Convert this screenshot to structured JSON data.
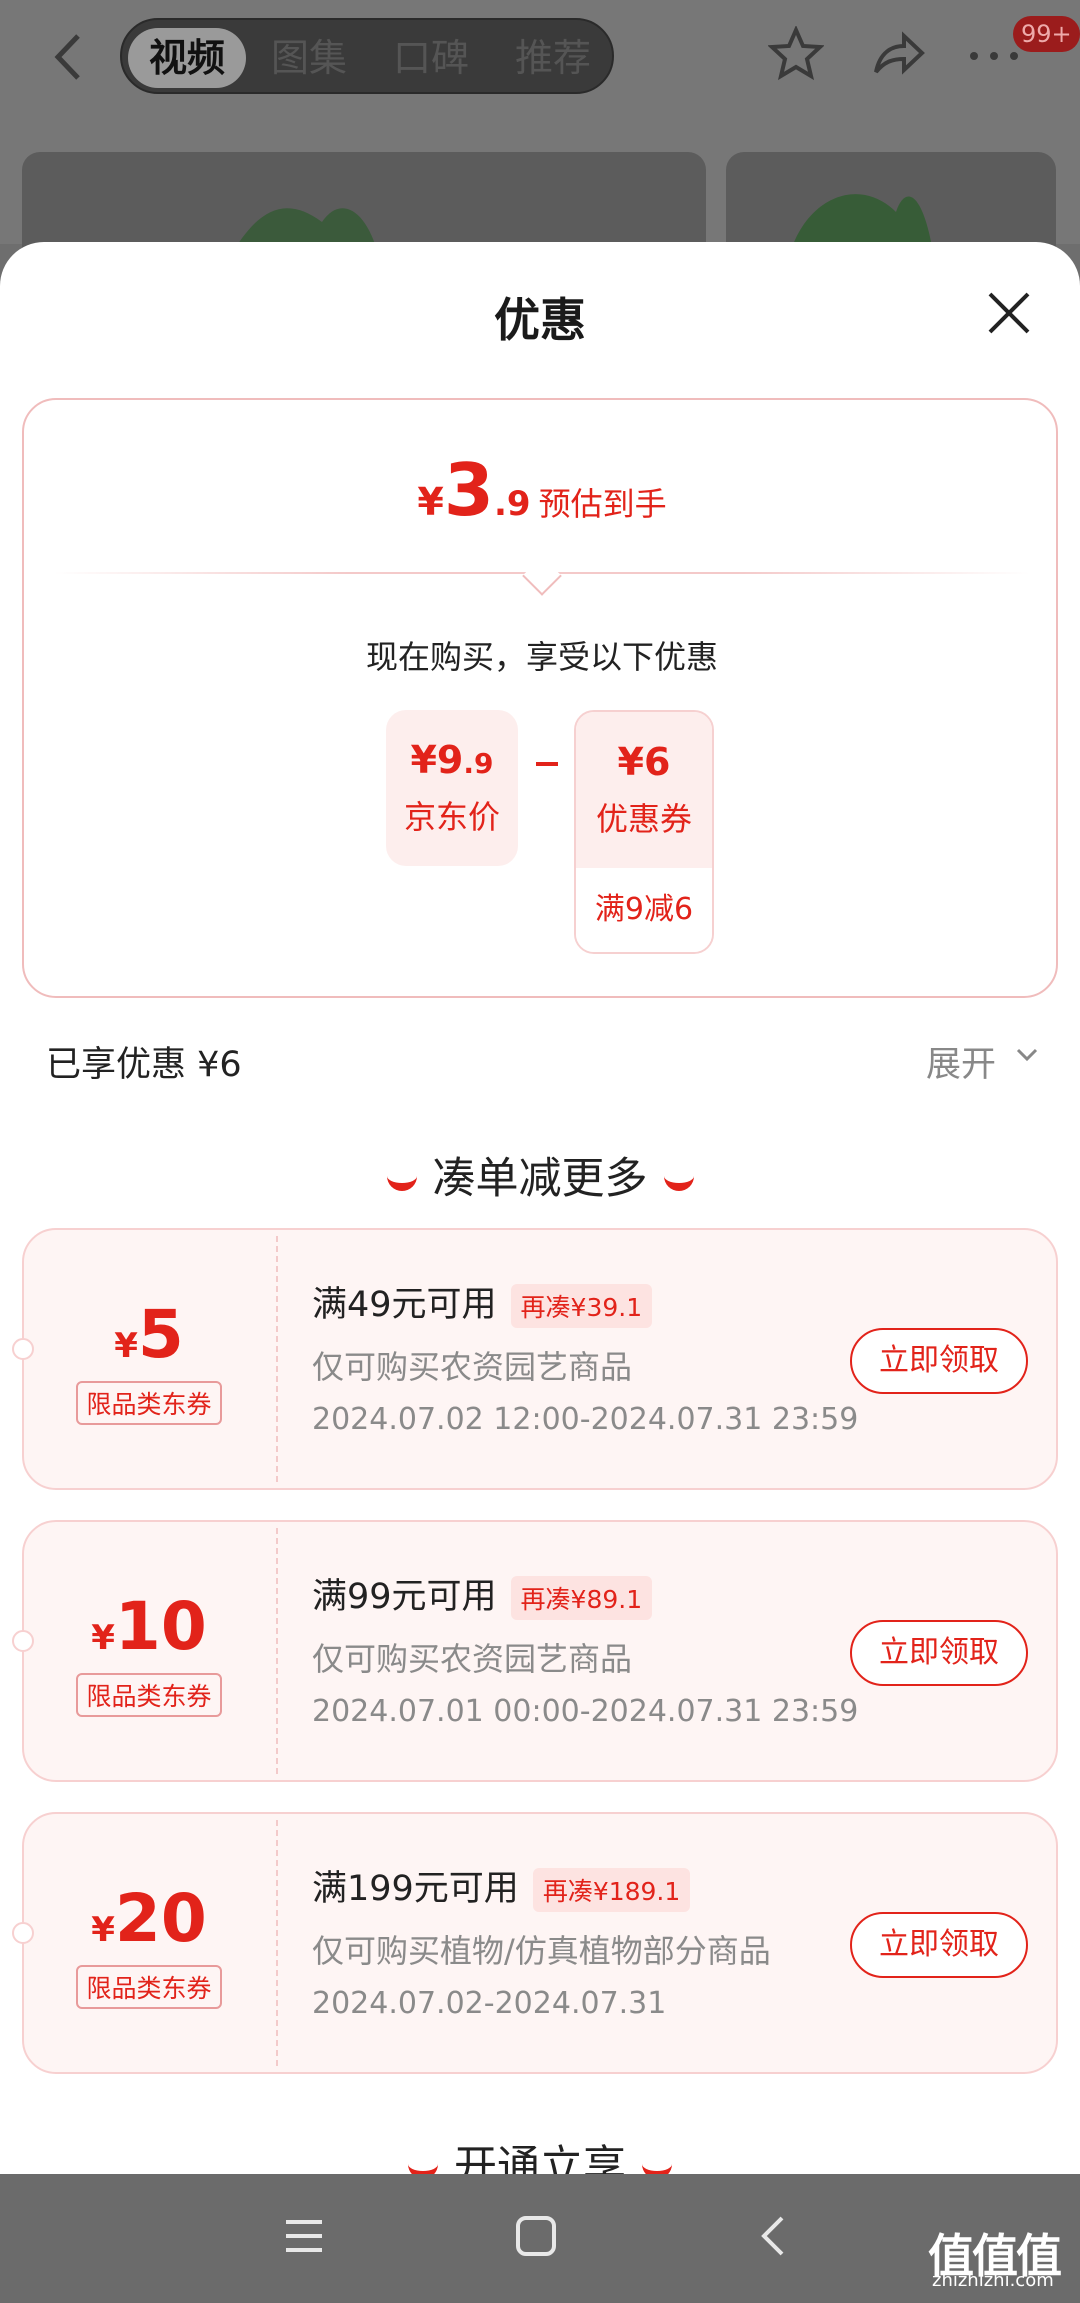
{
  "topbar": {
    "tabs": [
      "视频",
      "图集",
      "口碑",
      "推荐"
    ],
    "active_tab": 0,
    "badge": "99+"
  },
  "sheet": {
    "title": "优惠",
    "estimate": {
      "yen": "¥",
      "integer": "3",
      "decimal": ".9",
      "label": "预估到手"
    },
    "buy_now_text": "现在购买，享受以下优惠",
    "jd_price": {
      "value_int": "¥9",
      "value_dec": ".9",
      "label": "京东价"
    },
    "coupon_box": {
      "value": "¥6",
      "label": "优惠券",
      "condition": "满9减6"
    },
    "enjoyed": "已享优惠 ¥6",
    "expand": "展开",
    "section_more": "凑单减更多",
    "section_next": "开通立享"
  },
  "coupons": [
    {
      "yen": "¥",
      "amount": "5",
      "tag": "限品类东券",
      "condition": "满49元可用",
      "need": "再凑¥39.1",
      "scope": "仅可购买农资园艺商品",
      "time": "2024.07.02 12:00-2024.07.31 23:59",
      "button": "立即领取"
    },
    {
      "yen": "¥",
      "amount": "10",
      "tag": "限品类东券",
      "condition": "满99元可用",
      "need": "再凑¥89.1",
      "scope": "仅可购买农资园艺商品",
      "time": "2024.07.01 00:00-2024.07.31 23:59",
      "button": "立即领取"
    },
    {
      "yen": "¥",
      "amount": "20",
      "tag": "限品类东券",
      "condition": "满199元可用",
      "need": "再凑¥189.1",
      "scope": "仅可购买植物/仿真植物部分商品",
      "time": "2024.07.02-2024.07.31",
      "button": "立即领取"
    }
  ],
  "watermark": {
    "main": "值值值",
    "sub": "zhizhizhi.com"
  },
  "colors": {
    "accent": "#e2231a",
    "coupon_bg": "#fef5f4",
    "dim_overlay": "#777777"
  },
  "icons": {
    "back": "back-arrow-icon",
    "star": "star-outline-icon",
    "share": "share-arrow-icon",
    "more": "more-dots-icon",
    "close": "close-icon",
    "chevron": "chevron-down-icon",
    "nav_menu": "menu-icon",
    "nav_home": "home-square-icon",
    "nav_back": "nav-back-icon"
  }
}
